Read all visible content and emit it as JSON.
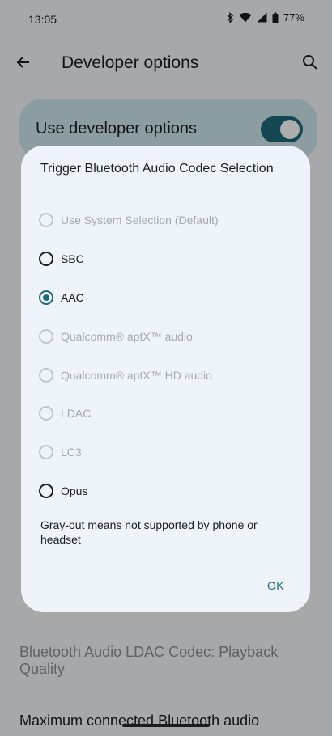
{
  "status_bar": {
    "time": "13:05",
    "battery": "77%"
  },
  "app_bar": {
    "title": "Developer options"
  },
  "master": {
    "label": "Use developer options",
    "checked": true
  },
  "background_items": [
    {
      "title": "Bluetooth Audio LDAC Codec: Playback Quality",
      "disabled": true
    },
    {
      "title": "Maximum connected Bluetooth audio",
      "disabled": false
    }
  ],
  "dialog": {
    "title": "Trigger Bluetooth Audio Codec Selection",
    "options": [
      {
        "label": "Use System Selection (Default)",
        "enabled": false,
        "checked": false
      },
      {
        "label": "SBC",
        "enabled": true,
        "checked": false
      },
      {
        "label": "AAC",
        "enabled": true,
        "checked": true
      },
      {
        "label": "Qualcomm® aptX™ audio",
        "enabled": false,
        "checked": false
      },
      {
        "label": "Qualcomm® aptX™ HD audio",
        "enabled": false,
        "checked": false
      },
      {
        "label": "LDAC",
        "enabled": false,
        "checked": false
      },
      {
        "label": "LC3",
        "enabled": false,
        "checked": false
      },
      {
        "label": "Opus",
        "enabled": true,
        "checked": false
      }
    ],
    "note": "Gray-out means not supported by phone or headset",
    "ok_label": "OK"
  }
}
